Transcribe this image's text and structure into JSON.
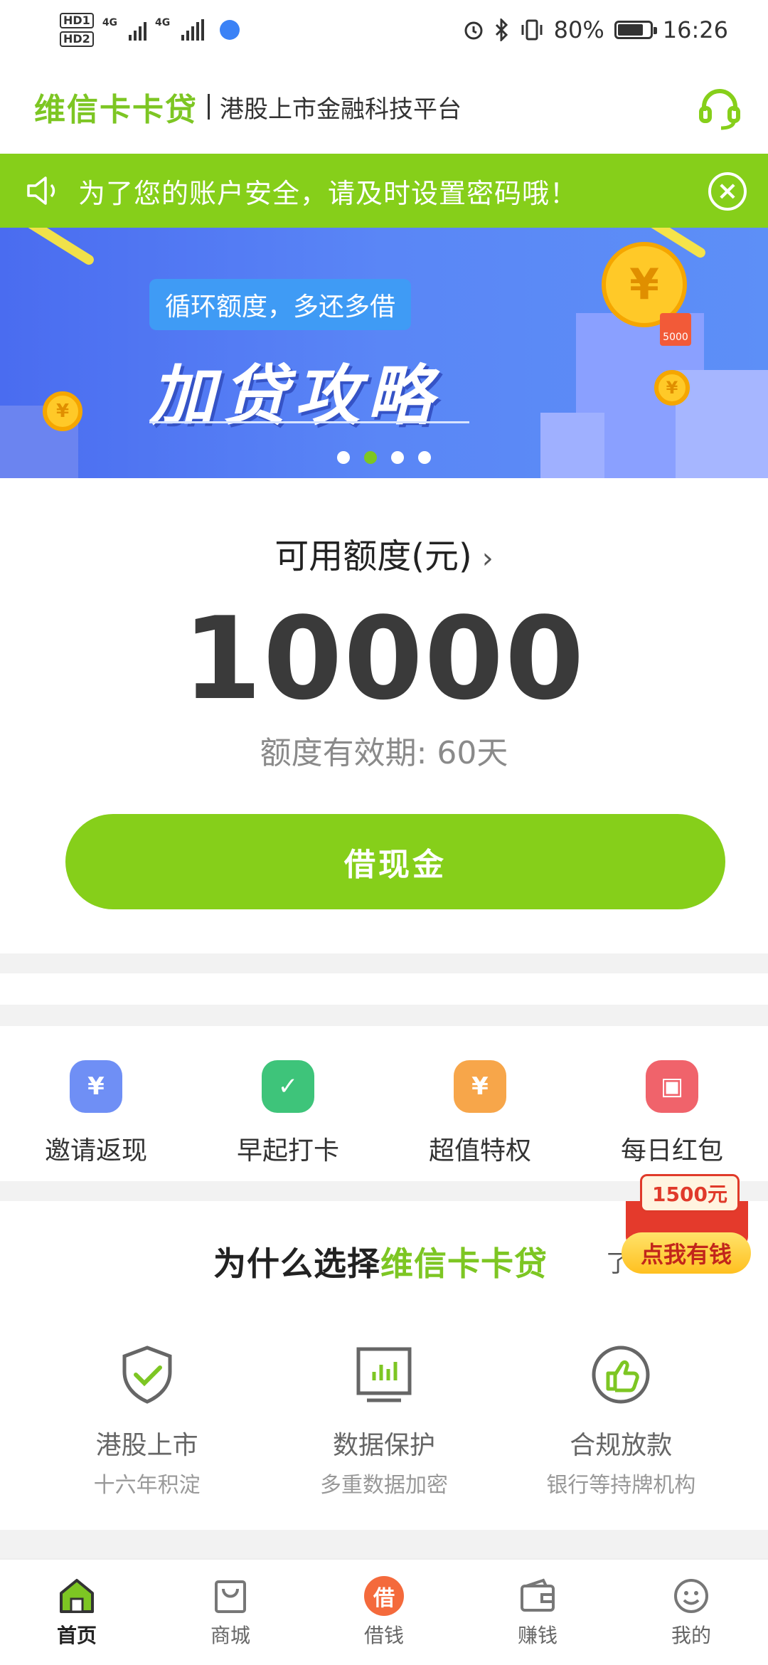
{
  "status_bar": {
    "hd1": "HD1",
    "hd2": "HD2",
    "net1": "4G",
    "net2": "4G",
    "battery": "80%",
    "time": "16:26"
  },
  "header": {
    "brand": "维信卡卡贷",
    "tagline": "港股上市金融科技平台",
    "icon": "headset-icon"
  },
  "notice": {
    "text": "为了您的账户安全，请及时设置密码哦！",
    "close": "×"
  },
  "banner": {
    "tag": "循环额度，多还多借",
    "title": "加贷攻略",
    "coin_symbol": "¥",
    "ticket": "5000",
    "page_count": 4,
    "active_index": 1
  },
  "credit": {
    "label": "可用额度(元)",
    "chevron": "›",
    "amount": "10000",
    "validity": "额度有效期: 60天",
    "borrow_button": "借现金"
  },
  "quick_actions": [
    {
      "label": "邀请返现",
      "icon": "money-bag-icon",
      "color": "#6f8ff5",
      "glyph": "¥"
    },
    {
      "label": "早起打卡",
      "icon": "calendar-check-icon",
      "color": "#3ec47a",
      "glyph": "✓"
    },
    {
      "label": "超值特权",
      "icon": "privilege-badge-icon",
      "color": "#f7a64a",
      "glyph": "¥"
    },
    {
      "label": "每日红包",
      "icon": "red-packet-icon",
      "color": "#f0636b",
      "glyph": "▣"
    }
  ],
  "why": {
    "title_prefix": "为什么选择",
    "title_brand": "维信卡卡贷",
    "more": "了",
    "features": [
      {
        "title": "港股上市",
        "subtitle": "十六年积淀",
        "icon": "shield-check-icon"
      },
      {
        "title": "数据保护",
        "subtitle": "多重数据加密",
        "icon": "chart-monitor-icon"
      },
      {
        "title": "合规放款",
        "subtitle": "银行等持牌机构",
        "icon": "thumbs-up-icon"
      }
    ]
  },
  "red_packet": {
    "amount": "1500元",
    "button": "点我有钱"
  },
  "bottom_nav": [
    {
      "label": "首页",
      "icon": "home-icon",
      "active": true
    },
    {
      "label": "商城",
      "icon": "shopping-bag-icon",
      "active": false
    },
    {
      "label": "借钱",
      "icon": "borrow-icon",
      "active": false,
      "glyph": "借"
    },
    {
      "label": "赚钱",
      "icon": "wallet-icon",
      "active": false
    },
    {
      "label": "我的",
      "icon": "profile-icon",
      "active": false
    }
  ],
  "colors": {
    "brand_green": "#86cf1a",
    "brand_text_green": "#7dc623",
    "amount_gray": "#3a3a3a"
  }
}
